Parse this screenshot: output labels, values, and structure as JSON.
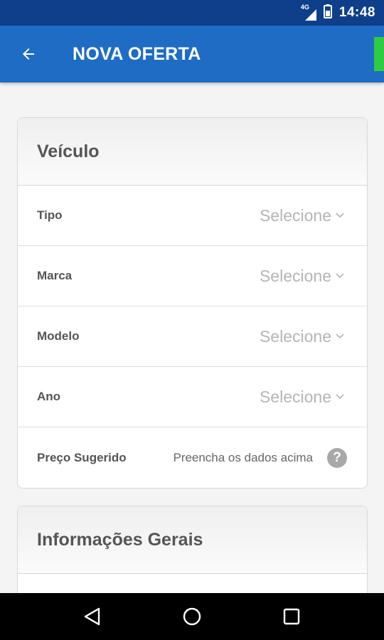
{
  "status_bar": {
    "network": "4G",
    "time": "14:48"
  },
  "app_bar": {
    "title": "NOVA OFERTA",
    "accent_color": "#2ecc40",
    "bar_color": "#1f6cc4"
  },
  "vehicle_card": {
    "title": "Veículo",
    "fields": [
      {
        "label": "Tipo",
        "value": "Selecione"
      },
      {
        "label": "Marca",
        "value": "Selecione"
      },
      {
        "label": "Modelo",
        "value": "Selecione"
      },
      {
        "label": "Ano",
        "value": "Selecione"
      }
    ],
    "price": {
      "label": "Preço Sugerido",
      "hint": "Preencha os dados acima",
      "help_icon": "?"
    }
  },
  "general_card": {
    "title": "Informações Gerais"
  },
  "nav_bar": {
    "icons": [
      "back-triangle-icon",
      "home-circle-icon",
      "recents-square-icon"
    ]
  }
}
